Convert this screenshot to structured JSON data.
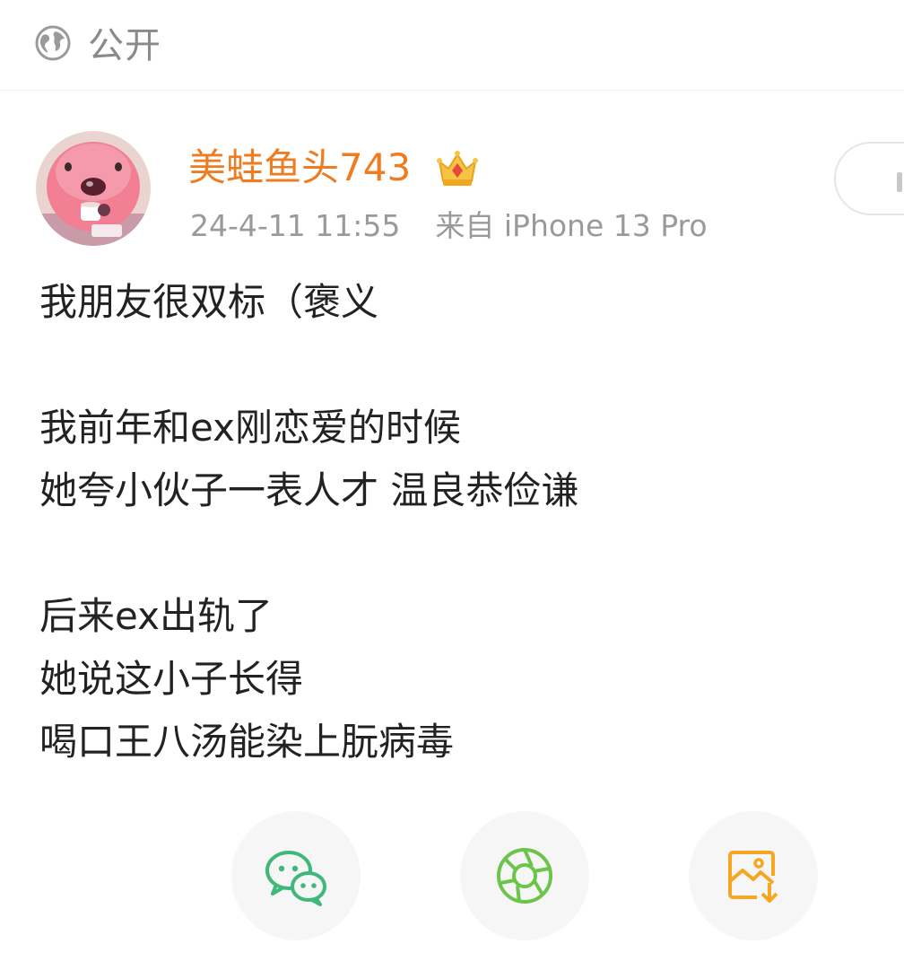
{
  "header": {
    "visibility_label": "公开",
    "visibility_icon": "globe-icon"
  },
  "author": {
    "username": "美蛙鱼头743",
    "badge_icon": "crown-icon",
    "timestamp": "24-4-11 11:55",
    "source": "来自 iPhone 13 Pro",
    "name_color": "#ee7d22"
  },
  "post": {
    "lines": [
      "我朋友很双标（褒义",
      "",
      "我前年和ex刚恋爱的时候",
      "她夸小伙子一表人才 温良恭俭谦",
      "",
      "后来ex出轨了",
      "她说这小子长得",
      "喝口王八汤能染上朊病毒"
    ]
  },
  "share_actions": [
    {
      "id": "share-wechat",
      "icon": "wechat-icon",
      "color": "#3fb87a"
    },
    {
      "id": "share-moments",
      "icon": "moments-icon",
      "color": "#6cc44a"
    },
    {
      "id": "share-save-image",
      "icon": "save-image-icon",
      "color": "#f5a623"
    }
  ]
}
